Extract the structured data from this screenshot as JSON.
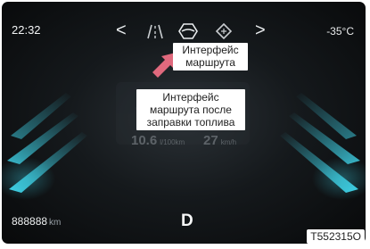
{
  "status_bar": {
    "time": "22:32",
    "temperature": "-35",
    "temperature_unit": "°C"
  },
  "nav": {
    "prev_glyph": "<",
    "next_glyph": ">",
    "icons": [
      "lane-road-icon",
      "route-hexagon-icon",
      "route-refuel-icon"
    ]
  },
  "trip": {
    "stat1_value": "10.6",
    "stat1_unit": "l/100km",
    "stat2_value": "27",
    "stat2_unit": "km/h"
  },
  "odometer": {
    "value": "888888",
    "unit": "km"
  },
  "gear": "D",
  "callouts": {
    "route_interface": "Интерфейс маршрута",
    "route_after_refuel": "Интерфейс маршрута после заправки топлива"
  },
  "figure_code": "T552315O",
  "colors": {
    "accent_cyan": "#4fd6e8",
    "pointer_pink": "#e0697d",
    "screen_bg": "#08090a"
  }
}
